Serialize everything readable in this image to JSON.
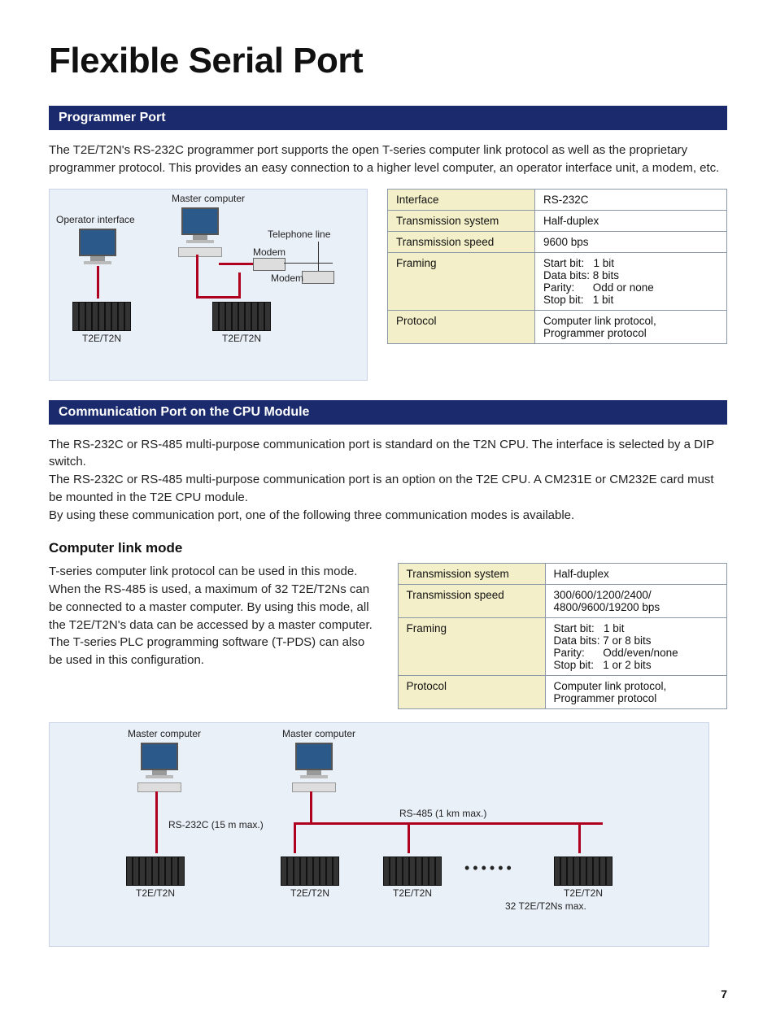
{
  "page": {
    "title": "Flexible Serial Port",
    "number": "7"
  },
  "section1": {
    "heading": "Programmer Port",
    "body": "The T2E/T2N's RS-232C programmer port supports the open T-series computer link protocol as well as the proprietary programmer protocol. This provides an easy connection to a higher level computer, an operator interface unit, a modem, etc.",
    "diagram": {
      "master_computer": "Master computer",
      "operator_interface": "Operator interface",
      "telephone_line": "Telephone line",
      "modem_1": "Modem",
      "modem_2": "Modem",
      "node_left": "T2E/T2N",
      "node_right": "T2E/T2N"
    },
    "table": {
      "r1k": "Interface",
      "r1v": "RS-232C",
      "r2k": "Transmission system",
      "r2v": "Half-duplex",
      "r3k": "Transmission speed",
      "r3v": "9600 bps",
      "r4k": "Framing",
      "r4v": "Start bit:   1 bit\nData bits: 8 bits\nParity:      Odd or none\nStop bit:   1 bit",
      "r5k": "Protocol",
      "r5v": "Computer link protocol,\nProgrammer protocol"
    }
  },
  "section2": {
    "heading": "Communication Port on the CPU Module",
    "body": "The RS-232C or RS-485 multi-purpose communication port is standard on the T2N CPU. The interface is selected by a DIP switch.\nThe RS-232C or RS-485 multi-purpose communication port is an option on the T2E CPU. A CM231E or CM232E card must be mounted in the T2E CPU module.\nBy using these communication port, one of the following three communication modes is available.",
    "subheading": "Computer link mode",
    "subbody": "T-series computer link protocol can be used in this mode. When the RS-485 is used, a maximum of 32 T2E/T2Ns can be connected to a master computer. By using this mode, all the T2E/T2N's data can be accessed by a master computer.\nThe T-series PLC programming software (T-PDS) can also be used in this configuration.",
    "table": {
      "r1k": "Transmission system",
      "r1v": "Half-duplex",
      "r2k": "Transmission speed",
      "r2v": "300/600/1200/2400/\n4800/9600/19200 bps",
      "r3k": "Framing",
      "r3v": "Start bit:   1 bit\nData bits: 7 or 8 bits\nParity:      Odd/even/none\nStop bit:   1 or 2 bits",
      "r4k": "Protocol",
      "r4v": "Computer link protocol,\nProgrammer protocol"
    },
    "diagram": {
      "master_left": "Master computer",
      "master_right": "Master computer",
      "rs232_label": "RS-232C (15 m max.)",
      "rs485_label": "RS-485 (1 km max.)",
      "node": "T2E/T2N",
      "max_label": "32 T2E/T2Ns max."
    }
  }
}
